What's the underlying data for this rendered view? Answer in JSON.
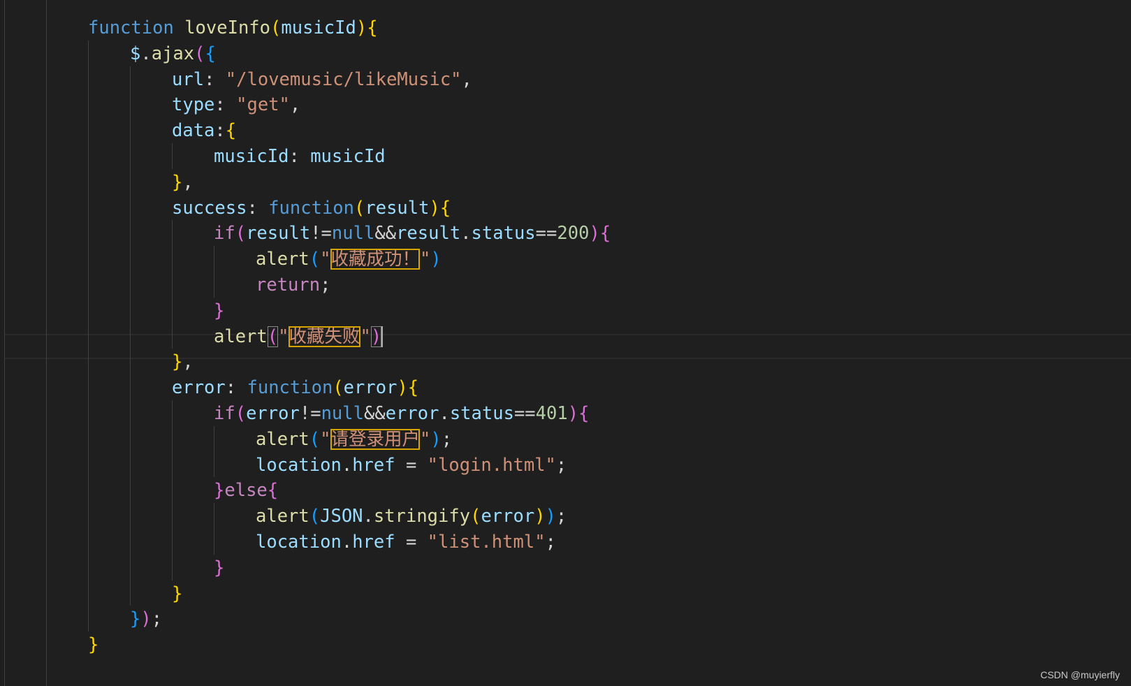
{
  "colors": {
    "background": "#1f1f1f",
    "keyword_blue": "#569cd6",
    "keyword_control": "#c586c0",
    "function_name": "#dcdcaa",
    "variable": "#9cdcfe",
    "string": "#ce9178",
    "number": "#b5cea8",
    "bracket_gold": "#ffd700",
    "bracket_pink": "#da70d6",
    "bracket_blue": "#179fff",
    "default_text": "#d4d4d4",
    "find_match_border": "#d7a500"
  },
  "watermark": "CSDN @muyierfly",
  "code_lines": [
    {
      "indent": 2,
      "tokens": [
        {
          "t": "function",
          "c": "#569cd6"
        },
        {
          "t": " "
        },
        {
          "t": "loveInfo",
          "c": "#dcdcaa"
        },
        {
          "t": "(",
          "c": "#ffd700"
        },
        {
          "t": "musicId",
          "c": "#9cdcfe"
        },
        {
          "t": ")",
          "c": "#ffd700"
        },
        {
          "t": "{",
          "c": "#ffd700"
        }
      ]
    },
    {
      "indent": 3,
      "tokens": [
        {
          "t": "$",
          "c": "#9cdcfe"
        },
        {
          "t": "."
        },
        {
          "t": "ajax",
          "c": "#dcdcaa"
        },
        {
          "t": "(",
          "c": "#da70d6"
        },
        {
          "t": "{",
          "c": "#179fff"
        }
      ]
    },
    {
      "indent": 4,
      "tokens": [
        {
          "t": "url",
          "c": "#9cdcfe"
        },
        {
          "t": ": "
        },
        {
          "t": "\"/lovemusic/likeMusic\"",
          "c": "#ce9178"
        },
        {
          "t": ","
        }
      ]
    },
    {
      "indent": 4,
      "tokens": [
        {
          "t": "type",
          "c": "#9cdcfe"
        },
        {
          "t": ": "
        },
        {
          "t": "\"get\"",
          "c": "#ce9178"
        },
        {
          "t": ","
        }
      ]
    },
    {
      "indent": 4,
      "tokens": [
        {
          "t": "data",
          "c": "#9cdcfe"
        },
        {
          "t": ":"
        },
        {
          "t": "{",
          "c": "#ffd700"
        }
      ]
    },
    {
      "indent": 5,
      "tokens": [
        {
          "t": "musicId",
          "c": "#9cdcfe"
        },
        {
          "t": ": "
        },
        {
          "t": "musicId",
          "c": "#9cdcfe"
        }
      ]
    },
    {
      "indent": 4,
      "tokens": [
        {
          "t": "}",
          "c": "#ffd700"
        },
        {
          "t": ","
        }
      ]
    },
    {
      "indent": 4,
      "tokens": [
        {
          "t": "success",
          "c": "#9cdcfe"
        },
        {
          "t": ": "
        },
        {
          "t": "function",
          "c": "#569cd6"
        },
        {
          "t": "(",
          "c": "#ffd700"
        },
        {
          "t": "result",
          "c": "#9cdcfe"
        },
        {
          "t": ")",
          "c": "#ffd700"
        },
        {
          "t": "{",
          "c": "#ffd700"
        }
      ]
    },
    {
      "indent": 5,
      "tokens": [
        {
          "t": "if",
          "c": "#c586c0"
        },
        {
          "t": "(",
          "c": "#da70d6"
        },
        {
          "t": "result",
          "c": "#9cdcfe"
        },
        {
          "t": "!="
        },
        {
          "t": "null",
          "c": "#569cd6"
        },
        {
          "t": "&&"
        },
        {
          "t": "result",
          "c": "#9cdcfe"
        },
        {
          "t": "."
        },
        {
          "t": "status",
          "c": "#9cdcfe"
        },
        {
          "t": "=="
        },
        {
          "t": "200",
          "c": "#b5cea8"
        },
        {
          "t": ")",
          "c": "#da70d6"
        },
        {
          "t": "{",
          "c": "#da70d6"
        }
      ]
    },
    {
      "indent": 6,
      "tokens": [
        {
          "t": "alert",
          "c": "#dcdcaa"
        },
        {
          "t": "(",
          "c": "#179fff"
        },
        {
          "t": "\"",
          "c": "#ce9178"
        },
        {
          "t": "收藏成功！",
          "c": "#ce9178",
          "hl": "find"
        },
        {
          "t": "\"",
          "c": "#ce9178"
        },
        {
          "t": ")",
          "c": "#179fff"
        }
      ]
    },
    {
      "indent": 6,
      "tokens": [
        {
          "t": "return",
          "c": "#c586c0"
        },
        {
          "t": ";"
        }
      ]
    },
    {
      "indent": 5,
      "tokens": [
        {
          "t": "}",
          "c": "#da70d6"
        }
      ]
    },
    {
      "indent": 5,
      "tokens": [
        {
          "t": "alert",
          "c": "#dcdcaa"
        },
        {
          "t": "(",
          "c": "#da70d6",
          "hl": "bracket"
        },
        {
          "t": "\"",
          "c": "#ce9178"
        },
        {
          "t": "收藏失败",
          "c": "#ce9178",
          "hl": "find"
        },
        {
          "t": "\"",
          "c": "#ce9178"
        },
        {
          "t": ")",
          "c": "#da70d6",
          "hl": "bracket"
        }
      ]
    },
    {
      "indent": 4,
      "tokens": [
        {
          "t": "}",
          "c": "#ffd700"
        },
        {
          "t": ","
        }
      ]
    },
    {
      "indent": 4,
      "tokens": [
        {
          "t": "error",
          "c": "#9cdcfe"
        },
        {
          "t": ": "
        },
        {
          "t": "function",
          "c": "#569cd6"
        },
        {
          "t": "(",
          "c": "#ffd700"
        },
        {
          "t": "error",
          "c": "#9cdcfe"
        },
        {
          "t": ")",
          "c": "#ffd700"
        },
        {
          "t": "{",
          "c": "#ffd700"
        }
      ]
    },
    {
      "indent": 5,
      "tokens": [
        {
          "t": "if",
          "c": "#c586c0"
        },
        {
          "t": "(",
          "c": "#da70d6"
        },
        {
          "t": "error",
          "c": "#9cdcfe"
        },
        {
          "t": "!="
        },
        {
          "t": "null",
          "c": "#569cd6"
        },
        {
          "t": "&&"
        },
        {
          "t": "error",
          "c": "#9cdcfe"
        },
        {
          "t": "."
        },
        {
          "t": "status",
          "c": "#9cdcfe"
        },
        {
          "t": "=="
        },
        {
          "t": "401",
          "c": "#b5cea8"
        },
        {
          "t": ")",
          "c": "#da70d6"
        },
        {
          "t": "{",
          "c": "#da70d6"
        }
      ]
    },
    {
      "indent": 6,
      "tokens": [
        {
          "t": "alert",
          "c": "#dcdcaa"
        },
        {
          "t": "(",
          "c": "#179fff"
        },
        {
          "t": "\"",
          "c": "#ce9178"
        },
        {
          "t": "请登录用户",
          "c": "#ce9178",
          "hl": "find"
        },
        {
          "t": "\"",
          "c": "#ce9178"
        },
        {
          "t": ")",
          "c": "#179fff"
        },
        {
          "t": ";"
        }
      ]
    },
    {
      "indent": 6,
      "tokens": [
        {
          "t": "location",
          "c": "#9cdcfe"
        },
        {
          "t": "."
        },
        {
          "t": "href",
          "c": "#9cdcfe"
        },
        {
          "t": " = "
        },
        {
          "t": "\"login.html\"",
          "c": "#ce9178"
        },
        {
          "t": ";"
        }
      ]
    },
    {
      "indent": 5,
      "tokens": [
        {
          "t": "}",
          "c": "#da70d6"
        },
        {
          "t": "else",
          "c": "#c586c0"
        },
        {
          "t": "{",
          "c": "#da70d6"
        }
      ]
    },
    {
      "indent": 6,
      "tokens": [
        {
          "t": "alert",
          "c": "#dcdcaa"
        },
        {
          "t": "(",
          "c": "#179fff"
        },
        {
          "t": "JSON",
          "c": "#9cdcfe"
        },
        {
          "t": "."
        },
        {
          "t": "stringify",
          "c": "#dcdcaa"
        },
        {
          "t": "(",
          "c": "#ffd700"
        },
        {
          "t": "error",
          "c": "#9cdcfe"
        },
        {
          "t": ")",
          "c": "#ffd700"
        },
        {
          "t": ")",
          "c": "#179fff"
        },
        {
          "t": ";"
        }
      ]
    },
    {
      "indent": 6,
      "tokens": [
        {
          "t": "location",
          "c": "#9cdcfe"
        },
        {
          "t": "."
        },
        {
          "t": "href",
          "c": "#9cdcfe"
        },
        {
          "t": " = "
        },
        {
          "t": "\"list.html\"",
          "c": "#ce9178"
        },
        {
          "t": ";"
        }
      ]
    },
    {
      "indent": 5,
      "tokens": [
        {
          "t": "}",
          "c": "#da70d6"
        }
      ]
    },
    {
      "indent": 4,
      "tokens": [
        {
          "t": "}",
          "c": "#ffd700"
        }
      ]
    },
    {
      "indent": 3,
      "tokens": [
        {
          "t": "}",
          "c": "#179fff"
        },
        {
          "t": ")",
          "c": "#da70d6"
        },
        {
          "t": ";"
        }
      ]
    },
    {
      "indent": 2,
      "tokens": [
        {
          "t": "}",
          "c": "#ffd700"
        }
      ]
    }
  ]
}
